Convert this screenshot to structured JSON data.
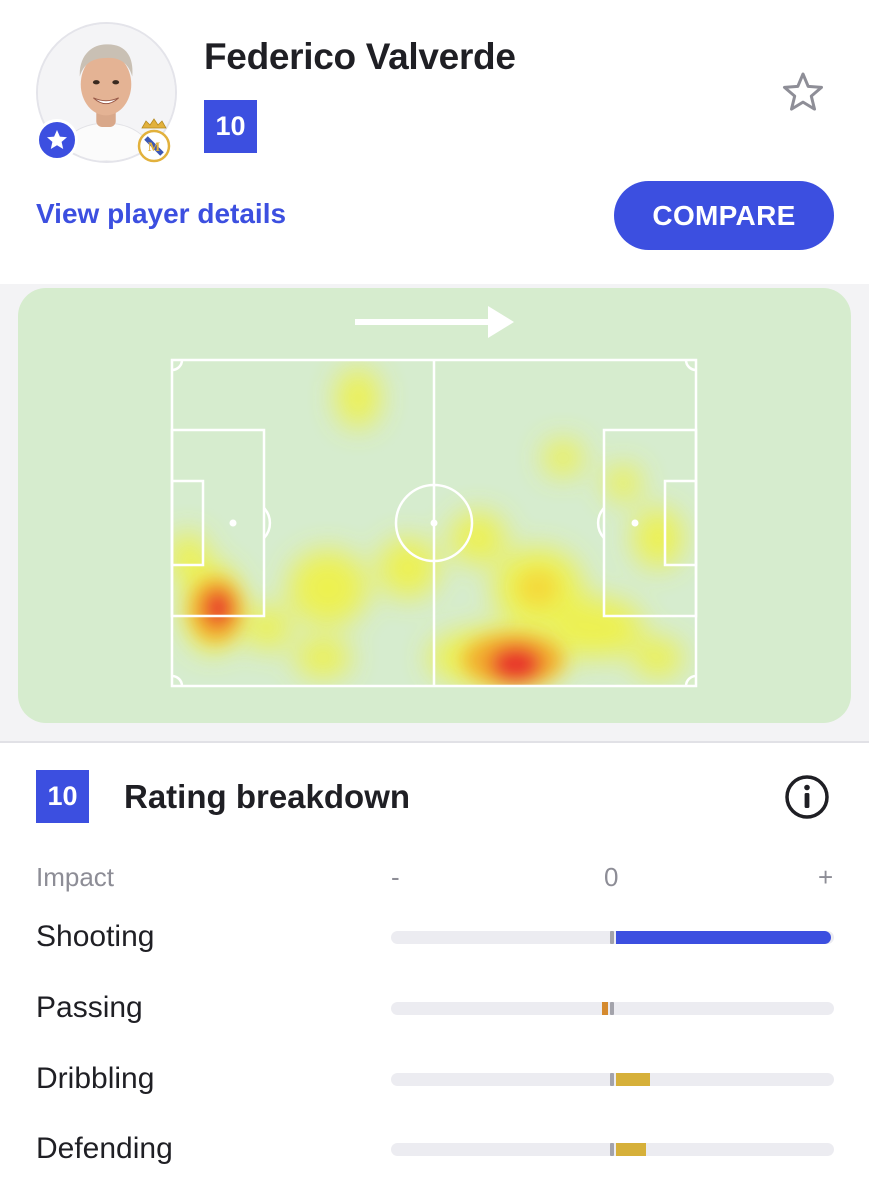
{
  "player": {
    "name": "Federico Valverde",
    "rating": "10",
    "details_link": "View player details",
    "compare_label": "COMPARE",
    "club_badge": "real-madrid-crest",
    "favorite_badge_icon": "star-icon",
    "follow_icon": "star-outline-icon"
  },
  "heatmap": {
    "direction_icon": "arrow-right-icon",
    "colors": {
      "pitch": "#d6ecce",
      "low": "#f2f23a",
      "mid": "#f3a62a",
      "high": "#e8332a"
    }
  },
  "rating_breakdown": {
    "rating": "10",
    "title": "Rating breakdown",
    "info_icon": "info-icon",
    "header": {
      "label": "Impact",
      "minus": "-",
      "zero": "0",
      "plus": "+"
    },
    "rows": [
      {
        "label": "Shooting",
        "impact": 1.0,
        "color": "#3c4fe0"
      },
      {
        "label": "Passing",
        "impact": -0.03,
        "color": "#d58a2e"
      },
      {
        "label": "Dribbling",
        "impact": 0.16,
        "color": "#d6b03a"
      },
      {
        "label": "Defending",
        "impact": 0.14,
        "color": "#d6b03a"
      }
    ]
  },
  "colors": {
    "accent": "#3c4fe0",
    "text": "#1f1f24",
    "muted": "#8d8d96"
  }
}
